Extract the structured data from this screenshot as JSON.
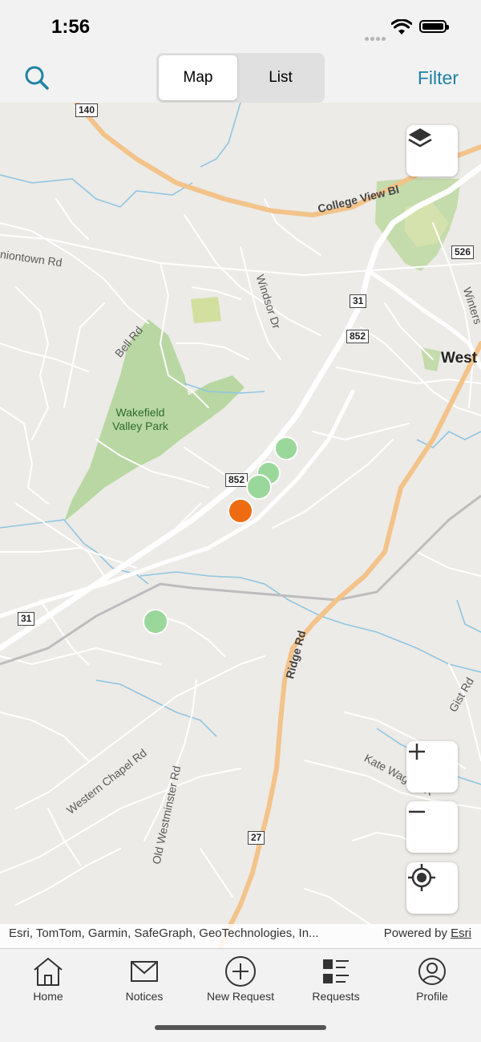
{
  "status": {
    "time": "1:56"
  },
  "header": {
    "search_icon": "search-icon",
    "segments": [
      "Map",
      "List"
    ],
    "selected_segment": "Map",
    "filter_label": "Filter",
    "accent_color": "#1f82a3"
  },
  "map": {
    "road_labels": {
      "college_view": "College View Bl",
      "uniontown": "niontown Rd",
      "windsor": "Windsor Dr",
      "bell": "Bell Rd",
      "ridge": "Ridge Rd",
      "western_chapel": "Western Chapel Rd",
      "old_westminster": "Old Westminster Rd",
      "kate_wagner": "Kate Wagner R",
      "gist": "Gist Rd",
      "winters": "Winters",
      "west": "West"
    },
    "park_label": "Wakefield\nValley Park",
    "route_shields": [
      "140",
      "31",
      "852",
      "852",
      "31",
      "526",
      "27"
    ],
    "markers": [
      {
        "status": "open",
        "color": "#9ad79b"
      },
      {
        "status": "open",
        "color": "#9ad79b"
      },
      {
        "status": "open",
        "color": "#9ad79b"
      },
      {
        "status": "in-progress",
        "color": "#ee6b12"
      },
      {
        "status": "open",
        "color": "#9ad79b"
      }
    ],
    "layers_icon": "layers-icon",
    "zoom_in_icon": "plus-icon",
    "zoom_out_icon": "minus-icon",
    "locate_icon": "locate-icon",
    "attribution": "Esri, TomTom, Garmin, SafeGraph, GeoTechnologies, In...",
    "powered_by": "Powered by",
    "powered_by_link": "Esri"
  },
  "tabs": [
    {
      "label": "Home",
      "icon": "home-icon"
    },
    {
      "label": "Notices",
      "icon": "envelope-icon"
    },
    {
      "label": "New Request",
      "icon": "plus-circle-icon"
    },
    {
      "label": "Requests",
      "icon": "list-icon"
    },
    {
      "label": "Profile",
      "icon": "person-icon"
    }
  ]
}
